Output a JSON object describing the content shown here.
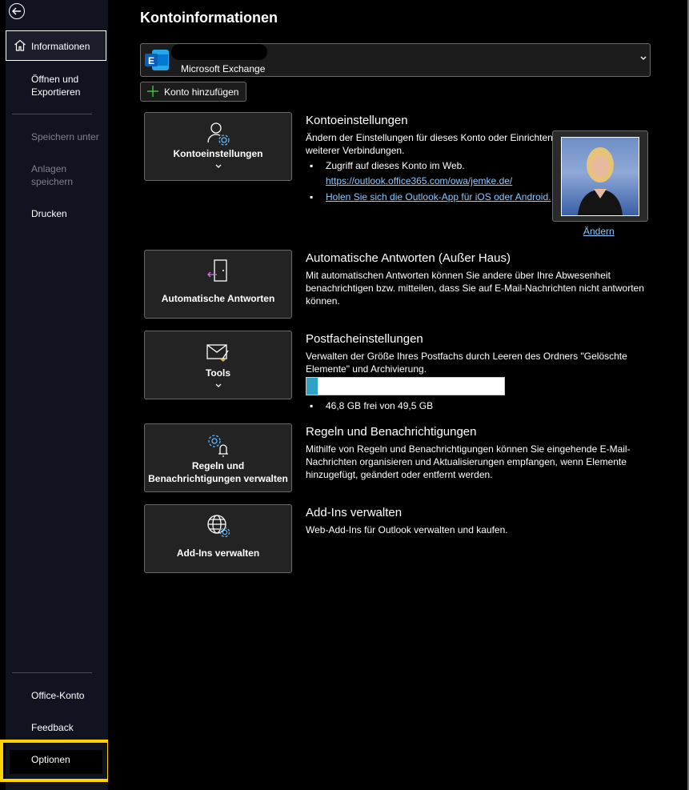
{
  "sidebar": {
    "active_item": "Informationen",
    "items": [
      "Öffnen und",
      "Exportieren",
      "Speichern unter",
      "Anlagen",
      "speichern",
      "Drucken"
    ],
    "bottom_items": [
      "Office-Konto",
      "Feedback",
      "Optionen"
    ]
  },
  "main": {
    "page_title": "Kontoinformationen",
    "account": {
      "type": "Microsoft Exchange",
      "badge_letter": "E"
    },
    "add_account_label": "Konto hinzufügen",
    "sections": {
      "konto": {
        "card_label": "Kontoeinstellungen",
        "title": "Kontoeinstellungen",
        "desc1": "Ändern der Einstellungen für dieses Konto oder Einrichten",
        "desc2": "weiterer Verbindungen.",
        "bullet1": "Zugriff auf dieses Konto im Web.",
        "link1": "https://outlook.office365.com/owa/jemke.de/",
        "link2": "Holen Sie sich die Outlook-App für iOS oder Android.",
        "change_label": "Ändern"
      },
      "auto": {
        "card_label": "Automatische Antworten",
        "title": "Automatische Antworten (Außer Haus)",
        "desc1": "Mit automatischen Antworten können Sie andere über Ihre Abwesenheit",
        "desc2": "benachrichtigen bzw. mitteilen, dass Sie auf E-Mail-Nachrichten nicht antworten",
        "desc3": "können."
      },
      "postfach": {
        "card_label": "Tools",
        "title": "Postfacheinstellungen",
        "desc1": "Verwalten der Größe Ihres Postfachs durch Leeren des Ordners \"Gelöschte",
        "desc2": "Elemente\" und Archivierung.",
        "usage_fraction": 0.056,
        "storage_text": "46,8 GB frei von 49,5 GB"
      },
      "regeln": {
        "card_label1": "Regeln und",
        "card_label2": "Benachrichtigungen verwalten",
        "title": "Regeln und Benachrichtigungen",
        "desc1": "Mithilfe von Regeln und Benachrichtigungen können Sie eingehende E-Mail-",
        "desc2": "Nachrichten organisieren und Aktualisierungen empfangen, wenn Elemente",
        "desc3": "hinzugefügt, geändert oder entfernt werden."
      },
      "addins": {
        "card_label": "Add-Ins verwalten",
        "title": "Add-Ins verwalten",
        "desc1": "Web-Add-Ins für Outlook verwalten und kaufen."
      }
    }
  },
  "colors": {
    "sidebar_bg": "#111321",
    "highlight": "#ffd200",
    "progress_fill": "#2fa3c4",
    "link": "#8cc8ff"
  }
}
